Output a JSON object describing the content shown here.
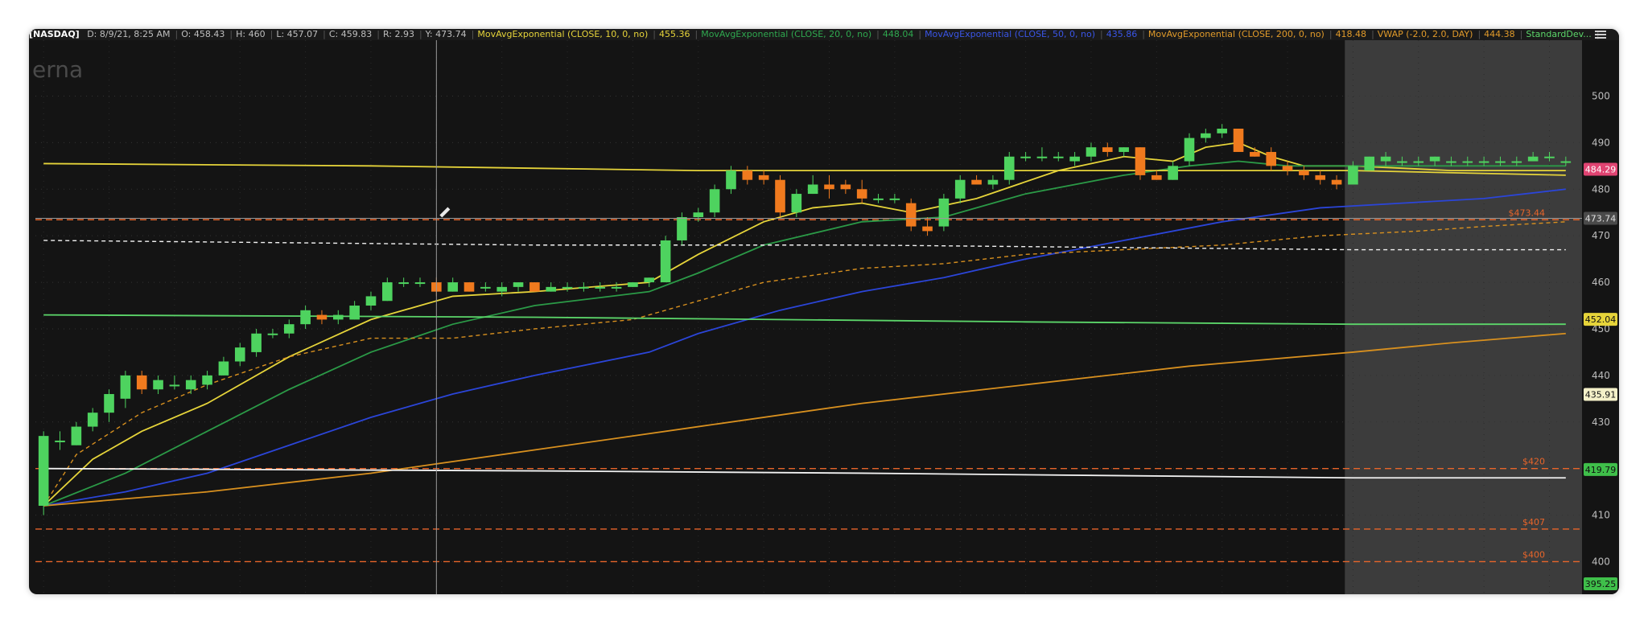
{
  "header": {
    "symbol": "[NASDAQ]",
    "items": [
      {
        "text": "D: 8/9/21, 8:25 AM",
        "color": "#bfbfbf"
      },
      {
        "text": "O: 458.43",
        "color": "#bfbfbf"
      },
      {
        "text": "H: 460",
        "color": "#bfbfbf"
      },
      {
        "text": "L: 457.07",
        "color": "#bfbfbf"
      },
      {
        "text": "C: 459.83",
        "color": "#bfbfbf"
      },
      {
        "text": "R: 2.93",
        "color": "#bfbfbf"
      },
      {
        "text": "Y: 473.74",
        "color": "#bfbfbf"
      },
      {
        "text": "MovAvgExponential (CLOSE, 10, 0, no)",
        "color": "#e6d43a"
      },
      {
        "text": "455.36",
        "color": "#e6d43a"
      },
      {
        "text": "MovAvgExponential (CLOSE, 20, 0, no)",
        "color": "#2fa84f"
      },
      {
        "text": "448.04",
        "color": "#2fa84f"
      },
      {
        "text": "MovAvgExponential (CLOSE, 50, 0, no)",
        "color": "#3a55e6"
      },
      {
        "text": "435.86",
        "color": "#3a55e6"
      },
      {
        "text": "MovAvgExponential (CLOSE, 200, 0, no)",
        "color": "#e09a2a"
      },
      {
        "text": "418.48",
        "color": "#e09a2a"
      },
      {
        "text": "VWAP (-2.0, 2.0, DAY)",
        "color": "#e09a2a"
      },
      {
        "text": "444.38",
        "color": "#e09a2a"
      },
      {
        "text": "StandardDev...",
        "color": "#5cd66a"
      }
    ]
  },
  "watermark": "erna",
  "colors": {
    "background": "#141414",
    "up_candle": "#4ed35f",
    "down_candle": "#f07a1e",
    "ema10": "#e6d43a",
    "ema20": "#2b9a47",
    "ema50": "#2b45d8",
    "ema200": "#d8901f",
    "stddev_line": "#5cd66a",
    "level_lines": "#e8652a",
    "future_shade": "#3c3c3c"
  },
  "chart_data": {
    "type": "candlestick",
    "y_range": [
      393,
      512
    ],
    "y_ticks": [
      400,
      410,
      420,
      430,
      440,
      450,
      460,
      470,
      480,
      490,
      500
    ],
    "candles": [
      {
        "o": 412,
        "h": 428,
        "l": 410,
        "c": 427
      },
      {
        "o": 426,
        "h": 428,
        "l": 424,
        "c": 426
      },
      {
        "o": 425,
        "h": 430,
        "l": 425,
        "c": 429
      },
      {
        "o": 429,
        "h": 433,
        "l": 428,
        "c": 432
      },
      {
        "o": 432,
        "h": 437,
        "l": 430,
        "c": 436
      },
      {
        "o": 435,
        "h": 441,
        "l": 433,
        "c": 440
      },
      {
        "o": 440,
        "h": 441,
        "l": 436,
        "c": 437
      },
      {
        "o": 437,
        "h": 440,
        "l": 436,
        "c": 439
      },
      {
        "o": 438,
        "h": 440,
        "l": 437,
        "c": 438
      },
      {
        "o": 437,
        "h": 440,
        "l": 436,
        "c": 439
      },
      {
        "o": 438,
        "h": 441,
        "l": 437,
        "c": 440
      },
      {
        "o": 440,
        "h": 444,
        "l": 440,
        "c": 443
      },
      {
        "o": 443,
        "h": 447,
        "l": 442,
        "c": 446
      },
      {
        "o": 445,
        "h": 450,
        "l": 444,
        "c": 449
      },
      {
        "o": 449,
        "h": 450,
        "l": 448,
        "c": 449
      },
      {
        "o": 449,
        "h": 452,
        "l": 448,
        "c": 451
      },
      {
        "o": 451,
        "h": 455,
        "l": 450,
        "c": 454
      },
      {
        "o": 453,
        "h": 454,
        "l": 451,
        "c": 452
      },
      {
        "o": 452,
        "h": 454,
        "l": 451,
        "c": 453
      },
      {
        "o": 452,
        "h": 456,
        "l": 452,
        "c": 455
      },
      {
        "o": 455,
        "h": 458,
        "l": 454,
        "c": 457
      },
      {
        "o": 456,
        "h": 461,
        "l": 456,
        "c": 460
      },
      {
        "o": 460,
        "h": 461,
        "l": 459,
        "c": 460
      },
      {
        "o": 460,
        "h": 461,
        "l": 459,
        "c": 460
      },
      {
        "o": 460,
        "h": 461,
        "l": 457,
        "c": 458
      },
      {
        "o": 458,
        "h": 461,
        "l": 458,
        "c": 460
      },
      {
        "o": 460,
        "h": 460,
        "l": 458,
        "c": 458
      },
      {
        "o": 459,
        "h": 460,
        "l": 458,
        "c": 459
      },
      {
        "o": 458,
        "h": 460,
        "l": 457,
        "c": 459
      },
      {
        "o": 459,
        "h": 460,
        "l": 458,
        "c": 460
      },
      {
        "o": 460,
        "h": 460,
        "l": 458,
        "c": 458
      },
      {
        "o": 458,
        "h": 460,
        "l": 458,
        "c": 459
      },
      {
        "o": 459,
        "h": 460,
        "l": 458,
        "c": 459
      },
      {
        "o": 459,
        "h": 460,
        "l": 458,
        "c": 459
      },
      {
        "o": 459,
        "h": 460,
        "l": 458,
        "c": 459
      },
      {
        "o": 459,
        "h": 460,
        "l": 458,
        "c": 459
      },
      {
        "o": 459,
        "h": 460,
        "l": 459,
        "c": 460
      },
      {
        "o": 460,
        "h": 461,
        "l": 459,
        "c": 461
      },
      {
        "o": 460,
        "h": 470,
        "l": 460,
        "c": 469
      },
      {
        "o": 469,
        "h": 475,
        "l": 468,
        "c": 474
      },
      {
        "o": 474,
        "h": 476,
        "l": 473,
        "c": 475
      },
      {
        "o": 475,
        "h": 481,
        "l": 474,
        "c": 480
      },
      {
        "o": 480,
        "h": 485,
        "l": 479,
        "c": 484
      },
      {
        "o": 484,
        "h": 485,
        "l": 481,
        "c": 482
      },
      {
        "o": 483,
        "h": 484,
        "l": 481,
        "c": 482
      },
      {
        "o": 482,
        "h": 483,
        "l": 474,
        "c": 475
      },
      {
        "o": 475,
        "h": 480,
        "l": 474,
        "c": 479
      },
      {
        "o": 479,
        "h": 483,
        "l": 479,
        "c": 481
      },
      {
        "o": 481,
        "h": 483,
        "l": 478,
        "c": 480
      },
      {
        "o": 481,
        "h": 482,
        "l": 479,
        "c": 480
      },
      {
        "o": 480,
        "h": 482,
        "l": 477,
        "c": 478
      },
      {
        "o": 478,
        "h": 479,
        "l": 477,
        "c": 478
      },
      {
        "o": 478,
        "h": 479,
        "l": 477,
        "c": 478
      },
      {
        "o": 477,
        "h": 478,
        "l": 471,
        "c": 472
      },
      {
        "o": 472,
        "h": 474,
        "l": 470,
        "c": 471
      },
      {
        "o": 472,
        "h": 479,
        "l": 471,
        "c": 478
      },
      {
        "o": 478,
        "h": 483,
        "l": 477,
        "c": 482
      },
      {
        "o": 482,
        "h": 483,
        "l": 481,
        "c": 481
      },
      {
        "o": 481,
        "h": 483,
        "l": 480,
        "c": 482
      },
      {
        "o": 482,
        "h": 488,
        "l": 481,
        "c": 487
      },
      {
        "o": 487,
        "h": 488,
        "l": 486,
        "c": 487
      },
      {
        "o": 487,
        "h": 489,
        "l": 486,
        "c": 487
      },
      {
        "o": 487,
        "h": 488,
        "l": 486,
        "c": 487
      },
      {
        "o": 486,
        "h": 488,
        "l": 485,
        "c": 487
      },
      {
        "o": 487,
        "h": 490,
        "l": 486,
        "c": 489
      },
      {
        "o": 489,
        "h": 490,
        "l": 487,
        "c": 488
      },
      {
        "o": 488,
        "h": 489,
        "l": 487,
        "c": 489
      },
      {
        "o": 489,
        "h": 489,
        "l": 482,
        "c": 483
      },
      {
        "o": 483,
        "h": 484,
        "l": 482,
        "c": 482
      },
      {
        "o": 482,
        "h": 486,
        "l": 482,
        "c": 485
      },
      {
        "o": 486,
        "h": 492,
        "l": 485,
        "c": 491
      },
      {
        "o": 491,
        "h": 493,
        "l": 490,
        "c": 492
      },
      {
        "o": 492,
        "h": 494,
        "l": 491,
        "c": 493
      },
      {
        "o": 493,
        "h": 493,
        "l": 488,
        "c": 488
      },
      {
        "o": 488,
        "h": 489,
        "l": 487,
        "c": 487
      },
      {
        "o": 488,
        "h": 489,
        "l": 484,
        "c": 485
      },
      {
        "o": 485,
        "h": 486,
        "l": 483,
        "c": 484
      },
      {
        "o": 484,
        "h": 485,
        "l": 482,
        "c": 483
      },
      {
        "o": 483,
        "h": 484,
        "l": 481,
        "c": 482
      },
      {
        "o": 482,
        "h": 483,
        "l": 480,
        "c": 481
      },
      {
        "o": 481,
        "h": 486,
        "l": 481,
        "c": 485
      },
      {
        "o": 484,
        "h": 487,
        "l": 484,
        "c": 487
      },
      {
        "o": 486,
        "h": 488,
        "l": 485,
        "c": 487
      },
      {
        "o": 486,
        "h": 487,
        "l": 485,
        "c": 486
      },
      {
        "o": 486,
        "h": 487,
        "l": 485,
        "c": 486
      },
      {
        "o": 486,
        "h": 487,
        "l": 485,
        "c": 487
      },
      {
        "o": 486,
        "h": 487,
        "l": 485,
        "c": 486
      },
      {
        "o": 486,
        "h": 487,
        "l": 485,
        "c": 486
      },
      {
        "o": 486,
        "h": 487,
        "l": 485,
        "c": 486
      },
      {
        "o": 486,
        "h": 487,
        "l": 485,
        "c": 486
      },
      {
        "o": 486,
        "h": 487,
        "l": 485,
        "c": 486
      },
      {
        "o": 486,
        "h": 488,
        "l": 486,
        "c": 487
      },
      {
        "o": 487,
        "h": 488,
        "l": 486,
        "c": 487
      },
      {
        "o": 486,
        "h": 487,
        "l": 485,
        "c": 486
      }
    ],
    "series": [
      {
        "type": "line",
        "style": "solid",
        "color_key": "ema10",
        "values": [
          [
            0,
            412
          ],
          [
            3,
            422
          ],
          [
            6,
            428
          ],
          [
            10,
            434
          ],
          [
            15,
            444
          ],
          [
            20,
            452
          ],
          [
            25,
            457
          ],
          [
            30,
            458
          ],
          [
            37,
            460
          ],
          [
            40,
            466
          ],
          [
            44,
            473
          ],
          [
            47,
            476
          ],
          [
            50,
            477
          ],
          [
            53,
            475
          ],
          [
            57,
            478
          ],
          [
            62,
            484
          ],
          [
            66,
            487
          ],
          [
            69,
            486
          ],
          [
            71,
            489
          ],
          [
            73,
            490
          ],
          [
            75,
            487
          ],
          [
            77,
            485
          ],
          [
            80,
            485
          ],
          [
            86,
            484
          ],
          [
            93,
            484
          ]
        ]
      },
      {
        "type": "line",
        "style": "solid",
        "color_key": "ema20",
        "values": [
          [
            0,
            412
          ],
          [
            5,
            419
          ],
          [
            10,
            428
          ],
          [
            15,
            437
          ],
          [
            20,
            445
          ],
          [
            25,
            451
          ],
          [
            30,
            455
          ],
          [
            37,
            458
          ],
          [
            40,
            462
          ],
          [
            44,
            468
          ],
          [
            50,
            473
          ],
          [
            55,
            474
          ],
          [
            60,
            479
          ],
          [
            66,
            483
          ],
          [
            70,
            485
          ],
          [
            73,
            486
          ],
          [
            76,
            485
          ],
          [
            80,
            485
          ],
          [
            86,
            485
          ],
          [
            93,
            485
          ]
        ]
      },
      {
        "type": "line",
        "style": "solid",
        "color_key": "ema50",
        "values": [
          [
            0,
            412
          ],
          [
            5,
            415
          ],
          [
            10,
            419
          ],
          [
            15,
            425
          ],
          [
            20,
            431
          ],
          [
            25,
            436
          ],
          [
            30,
            440
          ],
          [
            37,
            445
          ],
          [
            40,
            449
          ],
          [
            45,
            454
          ],
          [
            50,
            458
          ],
          [
            55,
            461
          ],
          [
            60,
            465
          ],
          [
            66,
            469
          ],
          [
            72,
            473
          ],
          [
            78,
            476
          ],
          [
            83,
            477
          ],
          [
            88,
            478
          ],
          [
            93,
            480
          ]
        ]
      },
      {
        "type": "line",
        "style": "dashed",
        "color_key": "ema200",
        "values": [
          [
            0,
            412
          ],
          [
            2,
            423
          ],
          [
            6,
            432
          ],
          [
            10,
            438
          ],
          [
            15,
            444
          ],
          [
            20,
            448
          ],
          [
            25,
            448
          ],
          [
            30,
            450
          ],
          [
            36,
            452
          ],
          [
            40,
            456
          ],
          [
            44,
            460
          ],
          [
            50,
            463
          ],
          [
            55,
            464
          ],
          [
            60,
            466
          ],
          [
            66,
            467
          ],
          [
            72,
            468
          ],
          [
            78,
            470
          ],
          [
            84,
            471
          ],
          [
            88,
            472
          ],
          [
            93,
            473
          ]
        ]
      },
      {
        "type": "line",
        "style": "solid",
        "color_key": "ema200",
        "values": [
          [
            0,
            412
          ],
          [
            10,
            415
          ],
          [
            20,
            419
          ],
          [
            30,
            424
          ],
          [
            40,
            429
          ],
          [
            50,
            434
          ],
          [
            60,
            438
          ],
          [
            70,
            442
          ],
          [
            80,
            445
          ],
          [
            86,
            447
          ],
          [
            93,
            449
          ]
        ]
      },
      {
        "type": "line",
        "style": "solid",
        "color_key": "ema10",
        "values": [
          [
            0,
            485.5
          ],
          [
            20,
            485
          ],
          [
            40,
            484
          ],
          [
            60,
            484
          ],
          [
            80,
            484
          ],
          [
            93,
            483
          ]
        ]
      },
      {
        "type": "line",
        "style": "solid",
        "color_key": "stddev_line",
        "values": [
          [
            0,
            453
          ],
          [
            30,
            452.5
          ],
          [
            60,
            451.5
          ],
          [
            80,
            451
          ],
          [
            93,
            451
          ]
        ]
      },
      {
        "type": "line",
        "style": "dashed",
        "color_key": "white",
        "values": [
          [
            0,
            469
          ],
          [
            30,
            468
          ],
          [
            50,
            468
          ],
          [
            80,
            467
          ],
          [
            93,
            467
          ]
        ]
      },
      {
        "type": "line",
        "style": "solid",
        "color_key": "white",
        "values": [
          [
            0,
            420
          ],
          [
            30,
            419.5
          ],
          [
            50,
            419
          ],
          [
            80,
            418
          ],
          [
            93,
            418
          ]
        ]
      }
    ],
    "levels": [
      {
        "value": 473.44,
        "label": "$473.44"
      },
      {
        "value": 420,
        "label": "$420"
      },
      {
        "value": 407,
        "label": "$407"
      },
      {
        "value": 400,
        "label": "$400"
      }
    ],
    "crosshair": {
      "candle_index": 24,
      "price": 473.74
    },
    "price_tags": [
      {
        "value": 484.29,
        "label": "484.29",
        "bg": "#e04472",
        "fg": "#ffffff"
      },
      {
        "value": 473.74,
        "label": "473.74",
        "bg": "#4a4a4a",
        "fg": "#e0e0e0"
      },
      {
        "value": 452.04,
        "label": "452.04",
        "bg": "#e6d43a",
        "fg": "#111111"
      },
      {
        "value": 435.91,
        "label": "435.91",
        "bg": "#f4f0c8",
        "fg": "#111111"
      },
      {
        "value": 419.79,
        "label": "419.79",
        "bg": "#3fbf4a",
        "fg": "#111111"
      },
      {
        "value": 395.25,
        "label": "395.25",
        "bg": "#3fbf4a",
        "fg": "#111111"
      }
    ],
    "future_shade_from_index": 80
  }
}
